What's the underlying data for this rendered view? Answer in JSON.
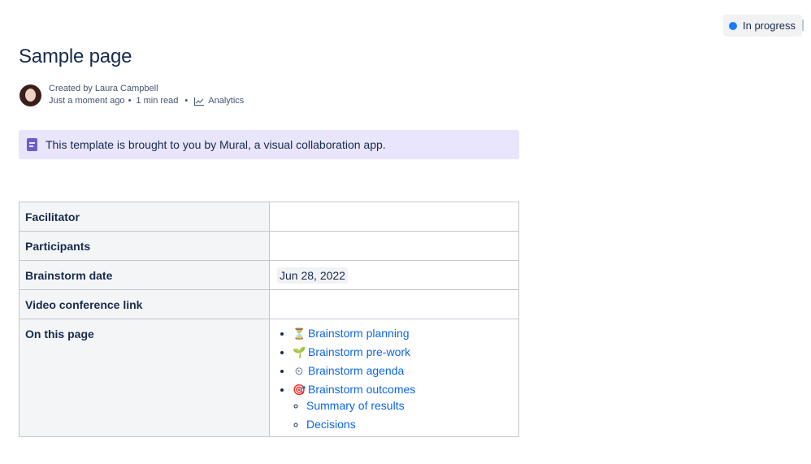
{
  "status": {
    "label": "In progress",
    "color": "#1d7afc"
  },
  "page": {
    "title": "Sample page"
  },
  "byline": {
    "created_by": "Created by Laura Campbell",
    "time": "Just a moment ago",
    "read": "1 min read",
    "analytics": "Analytics"
  },
  "info_panel": {
    "text": "This template is brought to you by Mural, a visual collaboration app."
  },
  "table": {
    "rows": [
      {
        "label": "Facilitator",
        "value": ""
      },
      {
        "label": "Participants",
        "value": ""
      },
      {
        "label": "Brainstorm date",
        "value": "Jun 28, 2022"
      },
      {
        "label": "Video conference link",
        "value": ""
      },
      {
        "label": "On this page"
      }
    ],
    "toc": [
      {
        "emoji": "⏳",
        "label": "Brainstorm planning"
      },
      {
        "emoji": "🌱",
        "label": "Brainstorm pre-work"
      },
      {
        "emoji": "⏲",
        "label": "Brainstorm agenda"
      },
      {
        "emoji": "🎯",
        "label": "Brainstorm outcomes"
      }
    ],
    "toc_sub": [
      {
        "label": "Summary of results"
      },
      {
        "label": "Decisions"
      }
    ]
  }
}
